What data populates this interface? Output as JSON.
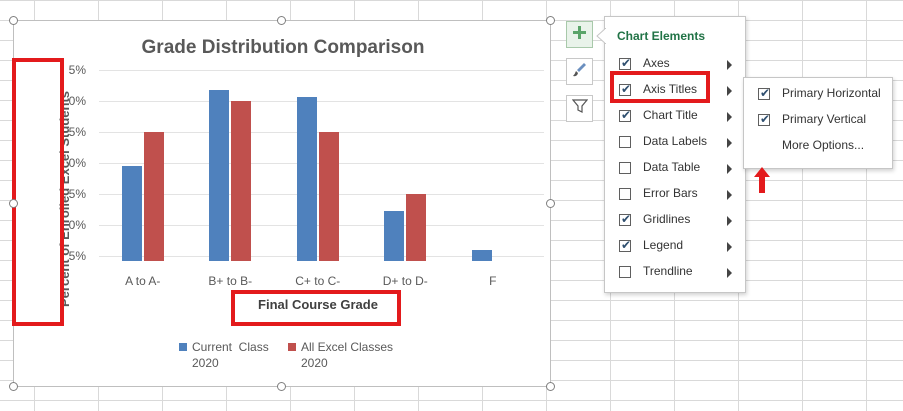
{
  "chart_data": {
    "type": "bar",
    "title": "Grade Distribution Comparison",
    "xlabel": "Final Course Grade",
    "ylabel": "Percent of Enrolled Excel Students",
    "categories": [
      "A to A-",
      "B+ to B-",
      "C+ to C-",
      "D+ to D-",
      "F"
    ],
    "y_tick_labels": [
      "5%",
      "0%",
      "5%",
      "0%",
      "5%",
      "0%",
      "5%"
    ],
    "series": [
      {
        "name": "Current  Class\n2020",
        "color": "#4f81bd",
        "values": [
          19.5,
          31.7,
          30.6,
          12.3,
          6.0
        ]
      },
      {
        "name": "All Excel Classes\n2020",
        "color": "#c0504d",
        "values": [
          25.0,
          30.0,
          25.0,
          15.0,
          0
        ]
      }
    ],
    "ylim": [
      5,
      35
    ],
    "grid": true,
    "legend_position": "bottom"
  },
  "chart_elements": {
    "title": "Chart Elements",
    "items": [
      {
        "label": "Axes",
        "checked": true
      },
      {
        "label": "Axis Titles",
        "checked": true
      },
      {
        "label": "Chart Title",
        "checked": true
      },
      {
        "label": "Data Labels",
        "checked": false
      },
      {
        "label": "Data Table",
        "checked": false
      },
      {
        "label": "Error Bars",
        "checked": false
      },
      {
        "label": "Gridlines",
        "checked": true
      },
      {
        "label": "Legend",
        "checked": true
      },
      {
        "label": "Trendline",
        "checked": false
      }
    ]
  },
  "axis_titles_submenu": {
    "items": [
      {
        "label": "Primary Horizontal",
        "checked": true
      },
      {
        "label": "Primary Vertical",
        "checked": true
      }
    ],
    "more_options": "More Options..."
  },
  "colors": {
    "accent_green": "#217346",
    "highlight_red": "#e31a1c"
  },
  "icons": {
    "add": "plus-icon",
    "styles": "paintbrush-icon",
    "filters": "funnel-icon"
  }
}
